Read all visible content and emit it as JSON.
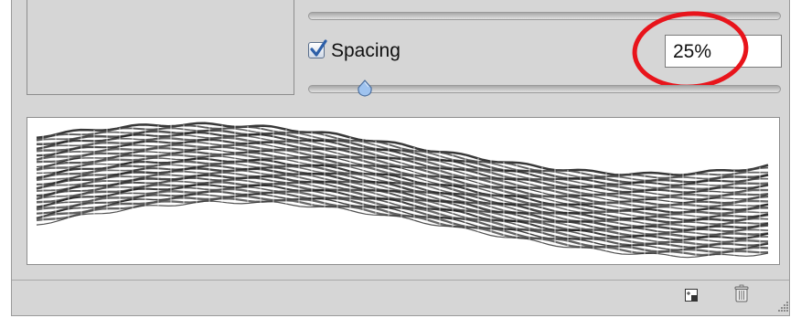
{
  "brush_settings": {
    "spacing_label": "Spacing",
    "spacing_checked": true,
    "spacing_value": "25%",
    "spacing_slider_fraction": 0.12
  },
  "colors": {
    "panel_bg": "#d6d6d6",
    "highlight_ring": "#e8141b",
    "checkbox_accent": "#2d5fa8"
  },
  "icons": {
    "footer": [
      "new-preset-icon",
      "trash-icon",
      "resize-grip-icon"
    ]
  }
}
